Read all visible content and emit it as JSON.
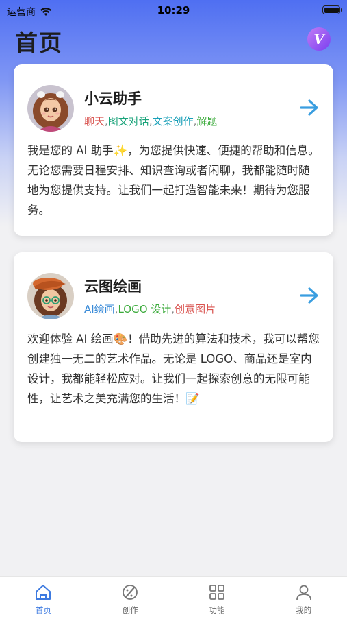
{
  "status": {
    "carrier": "运营商",
    "time": "10:29"
  },
  "header": {
    "title": "首页",
    "vip_badge": "V"
  },
  "cards": [
    {
      "title": "小云助手",
      "tags": [
        "聊天",
        "图文对话",
        "文案创作",
        "解题"
      ],
      "tag_colors": [
        "#d9534f",
        "#1aa37a",
        "#1aa0b8",
        "#3aaa3a"
      ],
      "description": "我是您的 AI 助手✨，为您提供快速、便捷的帮助和信息。无论您需要日程安排、知识查询或者闲聊，我都能随时随地为您提供支持。让我们一起打造智能未来！期待为您服务。"
    },
    {
      "title": "云图绘画",
      "tags": [
        "AI绘画",
        "LOGO 设计",
        "创意图片"
      ],
      "tag_colors": [
        "#3a8bd8",
        "#3aaa3a",
        "#d9534f"
      ],
      "description": "欢迎体验 AI 绘画🎨！借助先进的算法和技术，我可以帮您创建独一无二的艺术作品。无论是 LOGO、商品还是室内设计，我都能轻松应对。让我们一起探索创意的无限可能性，让艺术之美充满您的生活！📝"
    }
  ],
  "tabbar": [
    {
      "label": "首页",
      "icon": "home-icon",
      "active": true
    },
    {
      "label": "创作",
      "icon": "brush-icon",
      "active": false
    },
    {
      "label": "功能",
      "icon": "grid-icon",
      "active": false
    },
    {
      "label": "我的",
      "icon": "user-icon",
      "active": false
    }
  ],
  "colors": {
    "accent": "#3d7ae0",
    "arrow": "#3a9ee0",
    "tag_sep": "#888888"
  }
}
